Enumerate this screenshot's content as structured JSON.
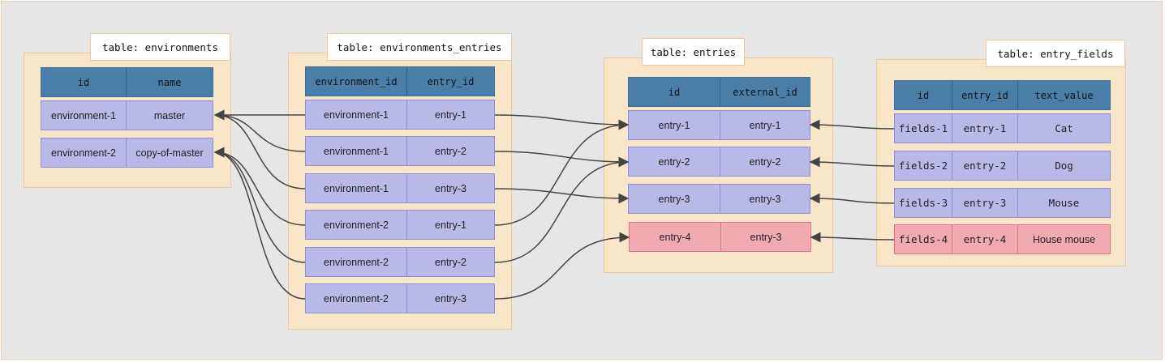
{
  "tables": {
    "environments": {
      "title": "table: environments",
      "columns": [
        "id",
        "name"
      ],
      "rows": [
        [
          "environment-1",
          "master"
        ],
        [
          "environment-2",
          "copy-of-master"
        ]
      ]
    },
    "environments_entries": {
      "title": "table: environments_entries",
      "columns": [
        "environment_id",
        "entry_id"
      ],
      "rows": [
        [
          "environment-1",
          "entry-1"
        ],
        [
          "environment-1",
          "entry-2"
        ],
        [
          "environment-1",
          "entry-3"
        ],
        [
          "environment-2",
          "entry-1"
        ],
        [
          "environment-2",
          "entry-2"
        ],
        [
          "environment-2",
          "entry-3"
        ]
      ]
    },
    "entries": {
      "title": "table: entries",
      "columns": [
        "id",
        "external_id"
      ],
      "rows": [
        [
          "entry-1",
          "entry-1"
        ],
        [
          "entry-2",
          "entry-2"
        ],
        [
          "entry-3",
          "entry-3"
        ],
        [
          "entry-4",
          "entry-3"
        ]
      ]
    },
    "entry_fields": {
      "title": "table: entry_fields",
      "columns": [
        "id",
        "entry_id",
        "text_value"
      ],
      "rows": [
        [
          "fields-1",
          "entry-1",
          "Cat"
        ],
        [
          "fields-2",
          "entry-2",
          "Dog"
        ],
        [
          "fields-3",
          "entry-3",
          "Mouse"
        ],
        [
          "fields-4",
          "entry-4",
          "House mouse"
        ]
      ]
    }
  },
  "colors": {
    "background": "#e6e6e6",
    "panel": "#f9e6c8",
    "header": "#4a7ea8",
    "row": "#b8b9e6",
    "highlight_row": "#f1a9b2",
    "connector": "#444444"
  }
}
